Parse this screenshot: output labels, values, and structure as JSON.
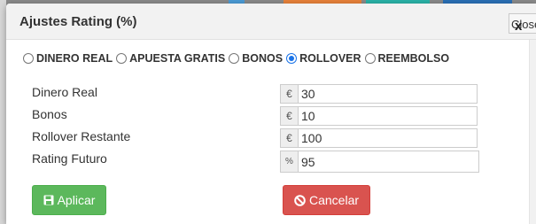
{
  "dialog": {
    "title": "Ajustes Rating (%)",
    "close_label": "Close",
    "close_icon": "x"
  },
  "radio_options": [
    {
      "label": "DINERO REAL",
      "checked": false
    },
    {
      "label": "APUESTA GRATIS",
      "checked": false
    },
    {
      "label": "BONOS",
      "checked": false
    },
    {
      "label": "ROLLOVER",
      "checked": true
    },
    {
      "label": "REEMBOLSO",
      "checked": false
    }
  ],
  "fields": [
    {
      "label": "Dinero Real",
      "unit": "€",
      "value": "30"
    },
    {
      "label": "Bonos",
      "unit": "€",
      "value": "10"
    },
    {
      "label": "Rollover Restante",
      "unit": "€",
      "value": "100"
    },
    {
      "label": "Rating Futuro",
      "unit": "%",
      "value": "95"
    }
  ],
  "buttons": {
    "apply_label": "Aplicar",
    "apply_icon": "floppy-disk-icon",
    "cancel_label": "Cancelar",
    "cancel_icon": "ban-icon"
  },
  "colors": {
    "apply": "#5cb85c",
    "cancel": "#d9534f",
    "radio_selected": "#1a73e8",
    "header_bg": "#f2f2f2"
  }
}
